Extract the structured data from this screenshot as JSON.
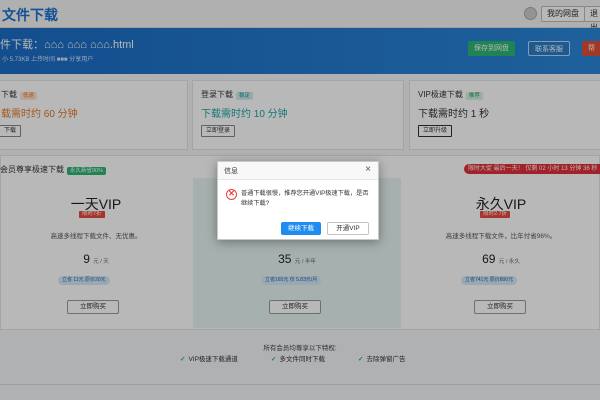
{
  "header": {
    "brand": "文件下载",
    "user_btn": "我的网盘",
    "logout_btn": "退出"
  },
  "file": {
    "title_prefix": "件下载：",
    "filename": "⌂⌂⌂ ⌂⌂⌂ ⌂⌂⌂.html",
    "meta": "小 5.73KB  上传时间 ■■■  分享用户",
    "save_btn": "保存到网盘",
    "service_btn": "联系客服",
    "help_btn": "帮"
  },
  "download_options": [
    {
      "title": "下载",
      "tag": "低速",
      "time": "载需时约 60 分钟",
      "button": "下载"
    },
    {
      "title": "登录下载",
      "tag": "稳定",
      "time": "下载需时约 10 分钟",
      "button": "立即登录"
    },
    {
      "title": "VIP极速下载",
      "tag": "推荐",
      "time": "下载需时约 1 秒",
      "button": "立即升级"
    }
  ],
  "vip": {
    "header": "会员尊享极速下载",
    "header_tag": "永久新省90%",
    "countdown": "限时大促 最后一天！ 仅剩 02 小时 13 分钟 36 秒",
    "plans": [
      {
        "name": "一天VIP",
        "badge": "限时7折",
        "desc": "高速多线程下载文件、无优惠。",
        "price": "9",
        "unit": "元 / 天",
        "save": "立省 11元 原价20元",
        "buy": "立即购买"
      },
      {
        "name": "",
        "badge": "",
        "desc": "",
        "price": "35",
        "unit": "元 / 半年",
        "save": "立省165元 仅 5.83元/月",
        "buy": "立即购买"
      },
      {
        "name": "永久VIP",
        "badge": "限时2.7折",
        "desc": "高速多线程下载文件，比年付省96%。",
        "price": "69",
        "unit": "元 / 永久",
        "save": "立省741元 原价800元",
        "buy": "立即购买"
      }
    ]
  },
  "perks": {
    "title": "所有会员均尊享以下特权:",
    "items": [
      "VIP极速下载通道",
      "多文件同时下载",
      "去除弹窗广告"
    ]
  },
  "dialog": {
    "title": "信息",
    "close": "×",
    "message": "普通下载很慢，推荐您开通VIP极速下载，是否继续下载?",
    "primary": "继续下载",
    "secondary": "开通VIP"
  },
  "colors": {
    "accent": "#1e8cf0",
    "warn": "#e8413b",
    "slow": "#e0782a",
    "teal": "#1aa5a5"
  }
}
